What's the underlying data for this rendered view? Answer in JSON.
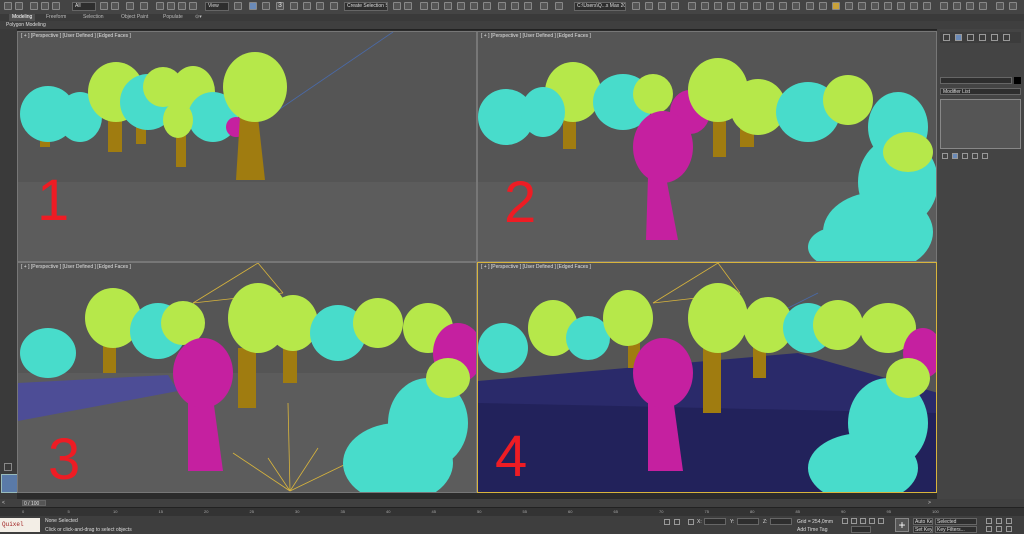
{
  "toolbar": {
    "selection_filter": "All",
    "view_dropdown": "View",
    "named_selection": "Create Selection Se",
    "file_path": "C:\\Users\\Q...s Max 2016",
    "snap_value": "3"
  },
  "ribbon": {
    "tabs": [
      "Modeling",
      "Freeform",
      "Selection",
      "Object Paint",
      "Populate"
    ],
    "active_panel": "Polygon Modeling"
  },
  "viewports": [
    {
      "label": "[ + ] [Perspective ] [User Defined ] [Edged Faces ]",
      "number": "1"
    },
    {
      "label": "[ + ] [Perspective ] [User Defined ] [Edged Faces ]",
      "number": "2"
    },
    {
      "label": "[ + ] [Perspective ] [User Defined ] [Edged Faces ]",
      "number": "3"
    },
    {
      "label": "[ + ] [Perspective ] [User Defined ] [Edged Faces ]",
      "number": "4"
    }
  ],
  "command_panel": {
    "modifier_list": "Modifier List"
  },
  "timeline": {
    "frame_counter": "0 / 100",
    "ticks": [
      "0",
      "5",
      "10",
      "15",
      "20",
      "25",
      "30",
      "35",
      "40",
      "45",
      "50",
      "55",
      "60",
      "65",
      "70",
      "75",
      "80",
      "85",
      "90",
      "95",
      "100"
    ]
  },
  "status": {
    "maxscript": "Quixel Bridg:",
    "selection": "None Selected",
    "prompt": "Click or click-and-drag to select objects",
    "x_label": "X:",
    "y_label": "Y:",
    "z_label": "Z:",
    "grid": "Grid = 254,0mm",
    "add_time_tag": "Add Time Tag",
    "auto_key": "Auto Key",
    "set_key": "Set Key",
    "selected": "Selected",
    "key_filters": "Key Filters..."
  },
  "colors": {
    "tree_green": "#b6e84a",
    "tree_cyan": "#48dccb",
    "tree_magenta": "#c520a0",
    "trunk": "#a07c10",
    "viewport_bg": "#5c5c5c",
    "active_border": "#d8b43c",
    "number_red": "#ee1c24"
  }
}
